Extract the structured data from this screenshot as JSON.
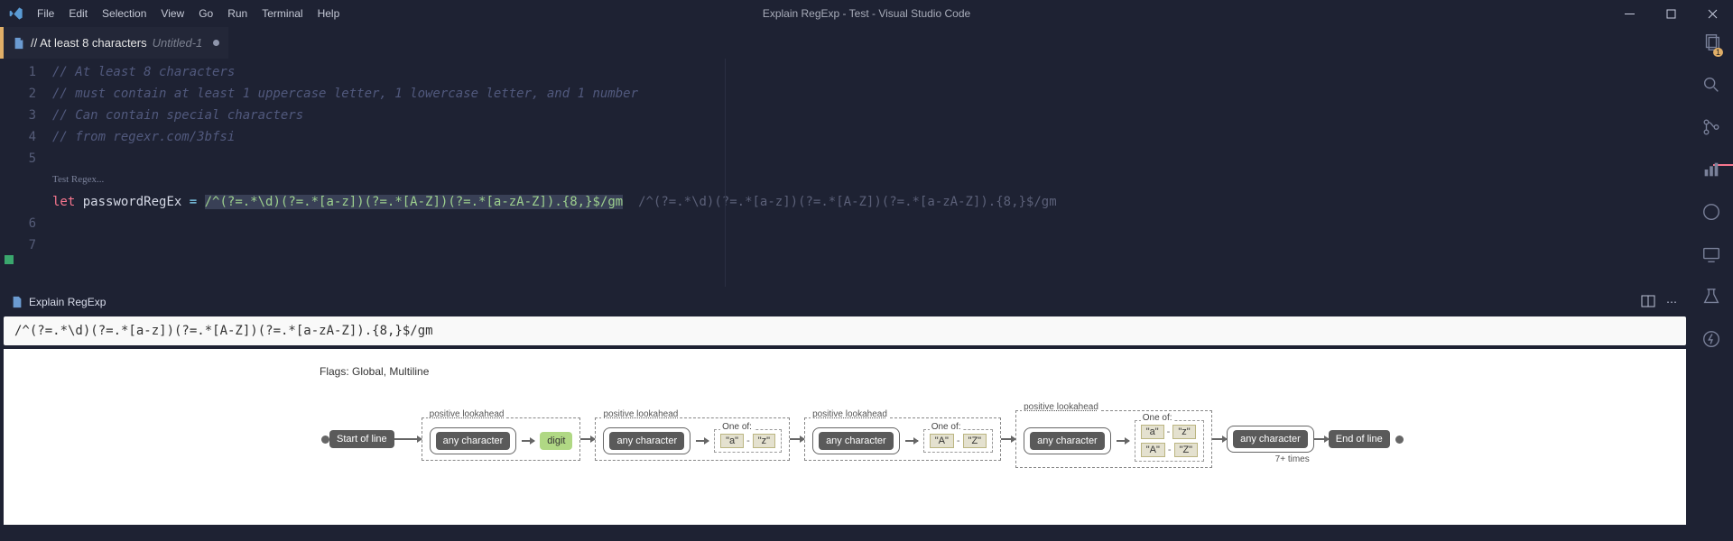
{
  "title": "Explain RegExp - Test - Visual Studio Code",
  "menu": {
    "file": "File",
    "edit": "Edit",
    "selection": "Selection",
    "view": "View",
    "go": "Go",
    "run": "Run",
    "terminal": "Terminal",
    "help": "Help"
  },
  "tab": {
    "label": "// At least 8 characters",
    "suffix": "Untitled-1"
  },
  "gutter": {
    "l1": "1",
    "l2": "2",
    "l3": "3",
    "l4": "4",
    "l5": "5",
    "l6": "6",
    "l7": "7"
  },
  "code": {
    "c1": "// At least 8 characters",
    "c2": "// must contain at least 1 uppercase letter, 1 lowercase letter, and 1 number",
    "c3": "// Can contain special characters",
    "c4": "// from regexr.com/3bfsi",
    "kw": "let",
    "id": "passwordRegEx",
    "eq": " = ",
    "rx": "/^(?=.*\\d)(?=.*[a-z])(?=.*[A-Z])(?=.*[a-zA-Z]).{8,}$/gm",
    "ov": "/^(?=.*\\d)(?=.*[a-z])(?=.*[A-Z])(?=.*[a-zA-Z]).{8,}$/gm"
  },
  "codelens": "Test Regex...",
  "panel": {
    "tab": "Explain RegExp"
  },
  "expr": "/^(?=.*\\d)(?=.*[a-z])(?=.*[A-Z])(?=.*[a-zA-Z]).{8,}$/gm",
  "flags": "Flags: Global, Multiline",
  "rail": {
    "sol": "Start of line",
    "eol": "End of line",
    "any": "any character",
    "digit": "digit",
    "look": "positive lookahead",
    "oneof": "One of:",
    "times": "7+ times",
    "a": "\"a\"",
    "z": "\"z\"",
    "A": "\"A\"",
    "Z": "\"Z\""
  }
}
